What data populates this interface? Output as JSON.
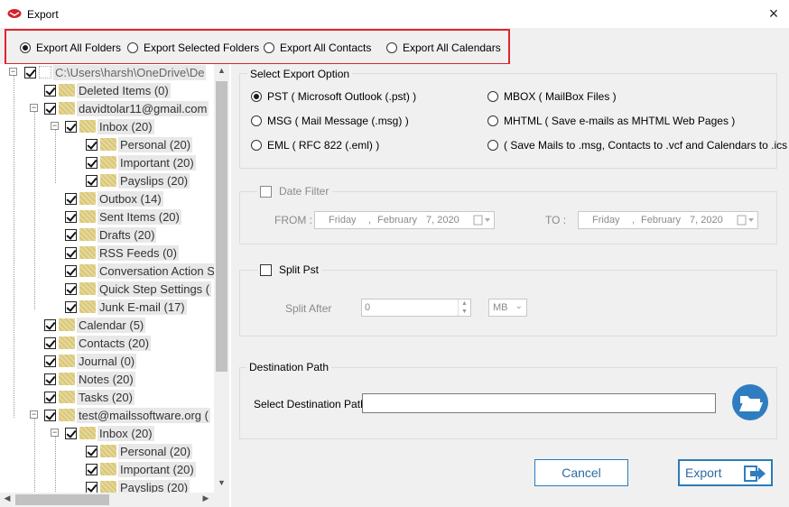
{
  "window": {
    "title": "Export",
    "close_glyph": "×",
    "icon": "mailbox-app-icon"
  },
  "export_modes": [
    {
      "label": "Export All Folders",
      "selected": true
    },
    {
      "label": "Export Selected Folders",
      "selected": false
    },
    {
      "label": "Export All Contacts",
      "selected": false
    },
    {
      "label": "Export All Calendars",
      "selected": false
    }
  ],
  "tree": {
    "root": "C:\\Users\\harsh\\OneDrive\\De",
    "items": [
      {
        "label": "Deleted Items (0)",
        "checked": true
      },
      {
        "label": "davidtolar11@gmail.com",
        "checked": true
      },
      {
        "label": "Inbox (20)",
        "checked": true
      },
      {
        "label": "Personal (20)",
        "checked": true
      },
      {
        "label": "Important (20)",
        "checked": true
      },
      {
        "label": "Payslips (20)",
        "checked": true
      },
      {
        "label": "Outbox (14)",
        "checked": true
      },
      {
        "label": "Sent Items (20)",
        "checked": true
      },
      {
        "label": "Drafts (20)",
        "checked": true
      },
      {
        "label": "RSS Feeds (0)",
        "checked": true
      },
      {
        "label": "Conversation Action S",
        "checked": true
      },
      {
        "label": "Quick Step Settings (",
        "checked": true
      },
      {
        "label": "Junk E-mail (17)",
        "checked": true
      },
      {
        "label": "Calendar (5)",
        "checked": true
      },
      {
        "label": "Contacts (20)",
        "checked": true
      },
      {
        "label": "Journal (0)",
        "checked": true
      },
      {
        "label": "Notes (20)",
        "checked": true
      },
      {
        "label": "Tasks (20)",
        "checked": true
      },
      {
        "label": "test@mailssoftware.org (",
        "checked": true
      },
      {
        "label": "Inbox (20)",
        "checked": true
      },
      {
        "label": "Personal (20)",
        "checked": true
      },
      {
        "label": "Important (20)",
        "checked": true
      },
      {
        "label": "Payslips (20)",
        "checked": true
      }
    ]
  },
  "export_option": {
    "group_title": "Select Export Option",
    "options": [
      {
        "label": "PST ( Microsoft Outlook (.pst) )",
        "selected": true
      },
      {
        "label": "MSG ( Mail Message (.msg) )",
        "selected": false
      },
      {
        "label": "EML ( RFC 822 (.eml) )",
        "selected": false
      },
      {
        "label": "MBOX ( MailBox Files )",
        "selected": false
      },
      {
        "label": "MHTML ( Save e-mails as MHTML Web Pages )",
        "selected": false
      },
      {
        "label": "( Save Mails to .msg, Contacts to .vcf and Calendars to .ics )",
        "selected": false
      }
    ]
  },
  "date_filter": {
    "label": "Date Filter",
    "checked": false,
    "from_label": "FROM :",
    "to_label": "TO :",
    "from": {
      "day": "Friday",
      "sep": ",",
      "month": "February",
      "date": "7, 2020"
    },
    "to": {
      "day": "Friday",
      "sep": ",",
      "month": "February",
      "date": "7, 2020"
    }
  },
  "split": {
    "label": "Split Pst",
    "checked": false,
    "after_label": "Split After",
    "value": "0",
    "unit": "MB"
  },
  "destination": {
    "group_title": "Destination Path",
    "label": "Select Destination Path",
    "value": "",
    "browse_icon": "open-folder-icon"
  },
  "buttons": {
    "cancel": "Cancel",
    "export": "Export"
  },
  "colors": {
    "highlight_border": "#e0242b",
    "button_accent": "#2b7bb9",
    "panel_bg": "#f0f0f0"
  }
}
